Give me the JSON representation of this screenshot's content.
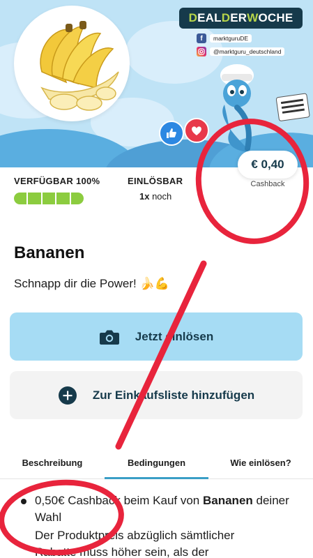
{
  "banner": {
    "deal_badge": {
      "part1": "D",
      "part2": "EAL ",
      "part3": "D",
      "part4": "ER ",
      "part5": "W",
      "part6": "OCHE"
    },
    "facebook_handle": "marktguruDE",
    "instagram_handle": "@marktguru_deutschland"
  },
  "stats": {
    "available_label": "VERFÜGBAR 100%",
    "available_fraction": 1.0,
    "redeemable_label": "EINLÖSBAR",
    "redeemable_count": "1x",
    "redeemable_suffix": " noch"
  },
  "cashback": {
    "amount": "€ 0,40",
    "label": "Cashback"
  },
  "product": {
    "title": "Bananen",
    "subtitle": "Schnapp dir die Power! 🍌💪"
  },
  "buttons": {
    "redeem": "Jetzt einlösen",
    "add_to_list": "Zur Einkaufsliste hinzufügen"
  },
  "tabs": [
    {
      "label": "Beschreibung",
      "active": false
    },
    {
      "label": "Bedingungen",
      "active": true
    },
    {
      "label": "Wie einlösen?",
      "active": false
    }
  ],
  "conditions": {
    "item1_pre": "0,50€ Cashback beim Kauf von ",
    "item1_bold": "Bananen",
    "item1_post": " deiner Wahl",
    "item2_line1": "Der Produktpreis abzüglich sämtlicher",
    "item2_line2": "Rabatte muss höher sein, als der"
  },
  "colors": {
    "accent_blue": "#a6dcf4",
    "brand_navy": "#163a4b",
    "available_green": "#8ccc3f",
    "tab_underline": "#3a9ec6",
    "annotation_red": "#e8243c"
  }
}
